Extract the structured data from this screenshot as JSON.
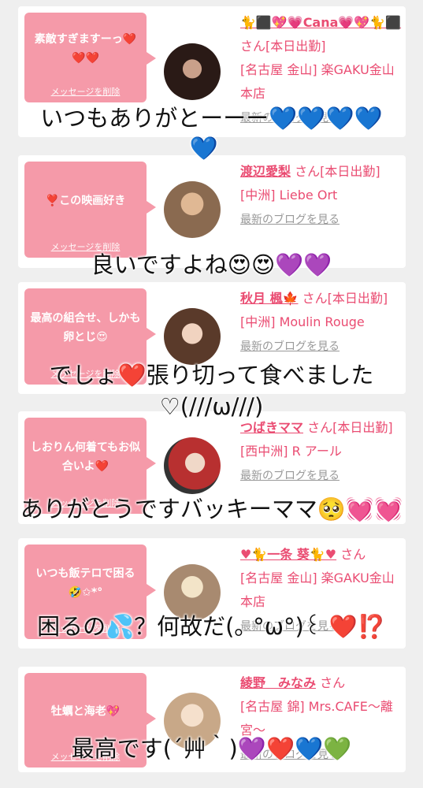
{
  "cards": [
    {
      "message": "素敵すぎますーっ❤️❤️❤️",
      "delete_label": "メッセージを削除",
      "name": "🐈⬛💖💗Cana💗💖🐈⬛",
      "status": "さん[本日出勤]",
      "shop": "[名古屋 金山] 楽GAKU金山本店",
      "blog_label": "最新のブログを見る"
    },
    {
      "message": "❣️この映画好き",
      "delete_label": "メッセージを削除",
      "name": "渡辺愛梨",
      "status": "さん[本日出勤]",
      "shop": "[中洲] Liebe Ort",
      "blog_label": "最新のブログを見る"
    },
    {
      "message": "最高の組合せ、しかも卵とじ😍",
      "delete_label": "メッセージを削除",
      "name": "秋月 楓🍁",
      "status": "さん[本日出勤]",
      "shop": "[中洲] Moulin Rouge",
      "blog_label": "最新のブログを見る"
    },
    {
      "message": "しおりん何着てもお似合いよ❤️",
      "delete_label": "メッセージを削除",
      "name": "つばきママ",
      "status": "さん[本日出勤]",
      "shop": "[西中洲] R アール",
      "blog_label": "最新のブログを見る"
    },
    {
      "message": "いつも飯テロで困る🤣✩*°",
      "delete_label": "メッセージを削除",
      "name": "♥🐈一条 葵🐈♥",
      "status": "さん",
      "shop": "[名古屋 金山] 楽GAKU金山本店",
      "blog_label": "最新のブログを見る"
    },
    {
      "message": "牡蠣と海老💖",
      "delete_label": "メッセージを削除",
      "name": "綾野　みなみ",
      "status": "さん",
      "shop": "[名古屋 錦] Mrs.CAFE〜離宮〜",
      "blog_label": "最新のブログを見る"
    }
  ],
  "overlays": [
    "いつもありがとーーー💙💙💙💙",
    "💙",
    "良いですよね😍😍💜💜",
    "でしょ❤️張り切って食べました",
    "♡(///ω///)",
    "ありがとうですバッキーママ🥺💓💓",
    "困るの💦？何故だ(｡ °ω°)꒰ ❤️⁉️",
    "最高です(´艸｀)💜❤️💙💚"
  ],
  "colors": {
    "accent": "#ea4c72",
    "bubble": "#f59aa9",
    "background": "#efefef"
  }
}
